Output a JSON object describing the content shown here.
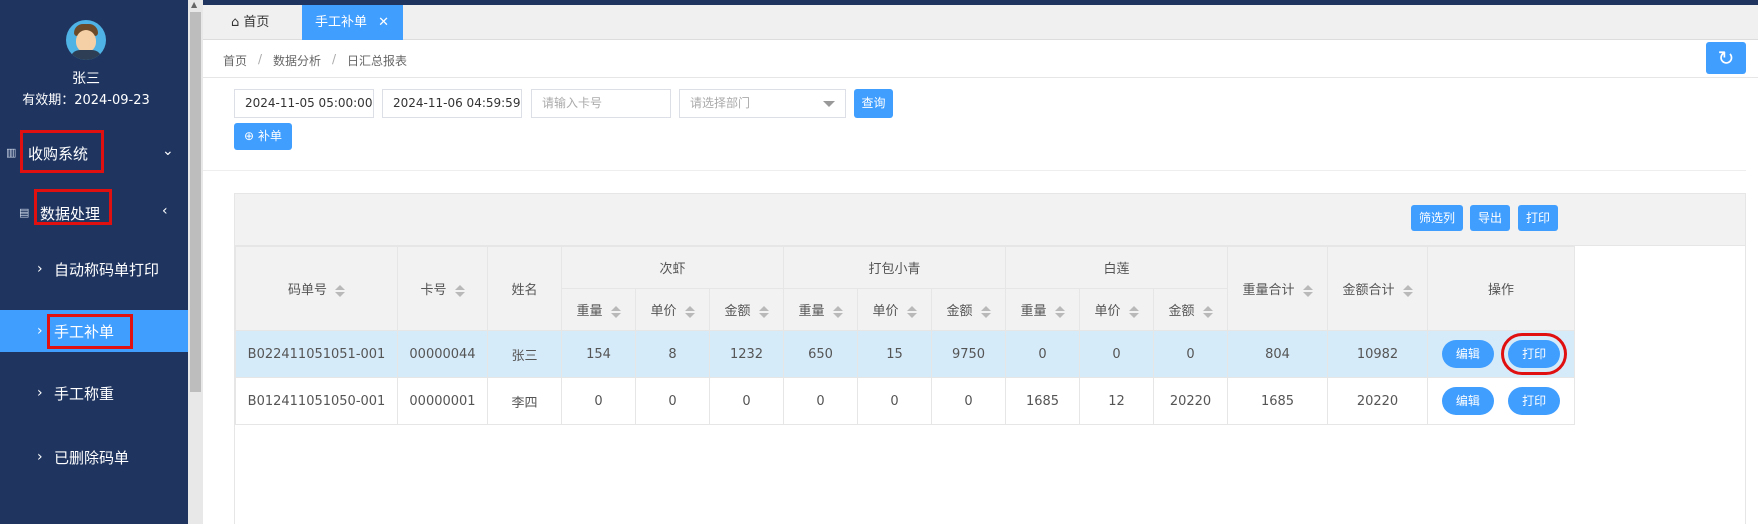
{
  "user": {
    "name": "张三",
    "valid_until": "有效期：2024-09-23"
  },
  "sidebar": {
    "groups": [
      {
        "label": "收购系统"
      },
      {
        "label": "数据处理"
      }
    ],
    "items": [
      {
        "label": "自动称码单打印"
      },
      {
        "label": "手工补单"
      },
      {
        "label": "手工称重"
      },
      {
        "label": "已删除码单"
      }
    ]
  },
  "tabs": [
    {
      "label": "首页"
    },
    {
      "label": "手工补单"
    }
  ],
  "breadcrumb": [
    "首页",
    "数据分析",
    "日汇总报表"
  ],
  "breadcrumb_sep": "/",
  "filters": {
    "start_time": "2024-11-05 05:00:00",
    "end_time": "2024-11-06 04:59:59",
    "card_placeholder": "请输入卡号",
    "dept_placeholder": "请选择部门",
    "query_label": "查询"
  },
  "add_button": "补单",
  "toolbar": {
    "filter_cols": "筛选列",
    "export": "导出",
    "print": "打印"
  },
  "table": {
    "headers": {
      "code": "码单号",
      "card": "卡号",
      "name": "姓名",
      "groups": [
        "次虾",
        "打包小青",
        "白莲"
      ],
      "sub": [
        "重量",
        "单价",
        "金额"
      ],
      "weight_total": "重量合计",
      "amount_total": "金额合计",
      "ops": "操作"
    },
    "rows": [
      {
        "code": "B022411051051-001",
        "card": "00000044",
        "name": "张三",
        "vals": [
          "154",
          "8",
          "1232",
          "650",
          "15",
          "9750",
          "0",
          "0",
          "0"
        ],
        "weight_total": "804",
        "amount_total": "10982"
      },
      {
        "code": "B012411051050-001",
        "card": "00000001",
        "name": "李四",
        "vals": [
          "0",
          "0",
          "0",
          "0",
          "0",
          "0",
          "1685",
          "12",
          "20220"
        ],
        "weight_total": "1685",
        "amount_total": "20220"
      }
    ],
    "row_actions": {
      "edit": "编辑",
      "print": "打印"
    }
  }
}
